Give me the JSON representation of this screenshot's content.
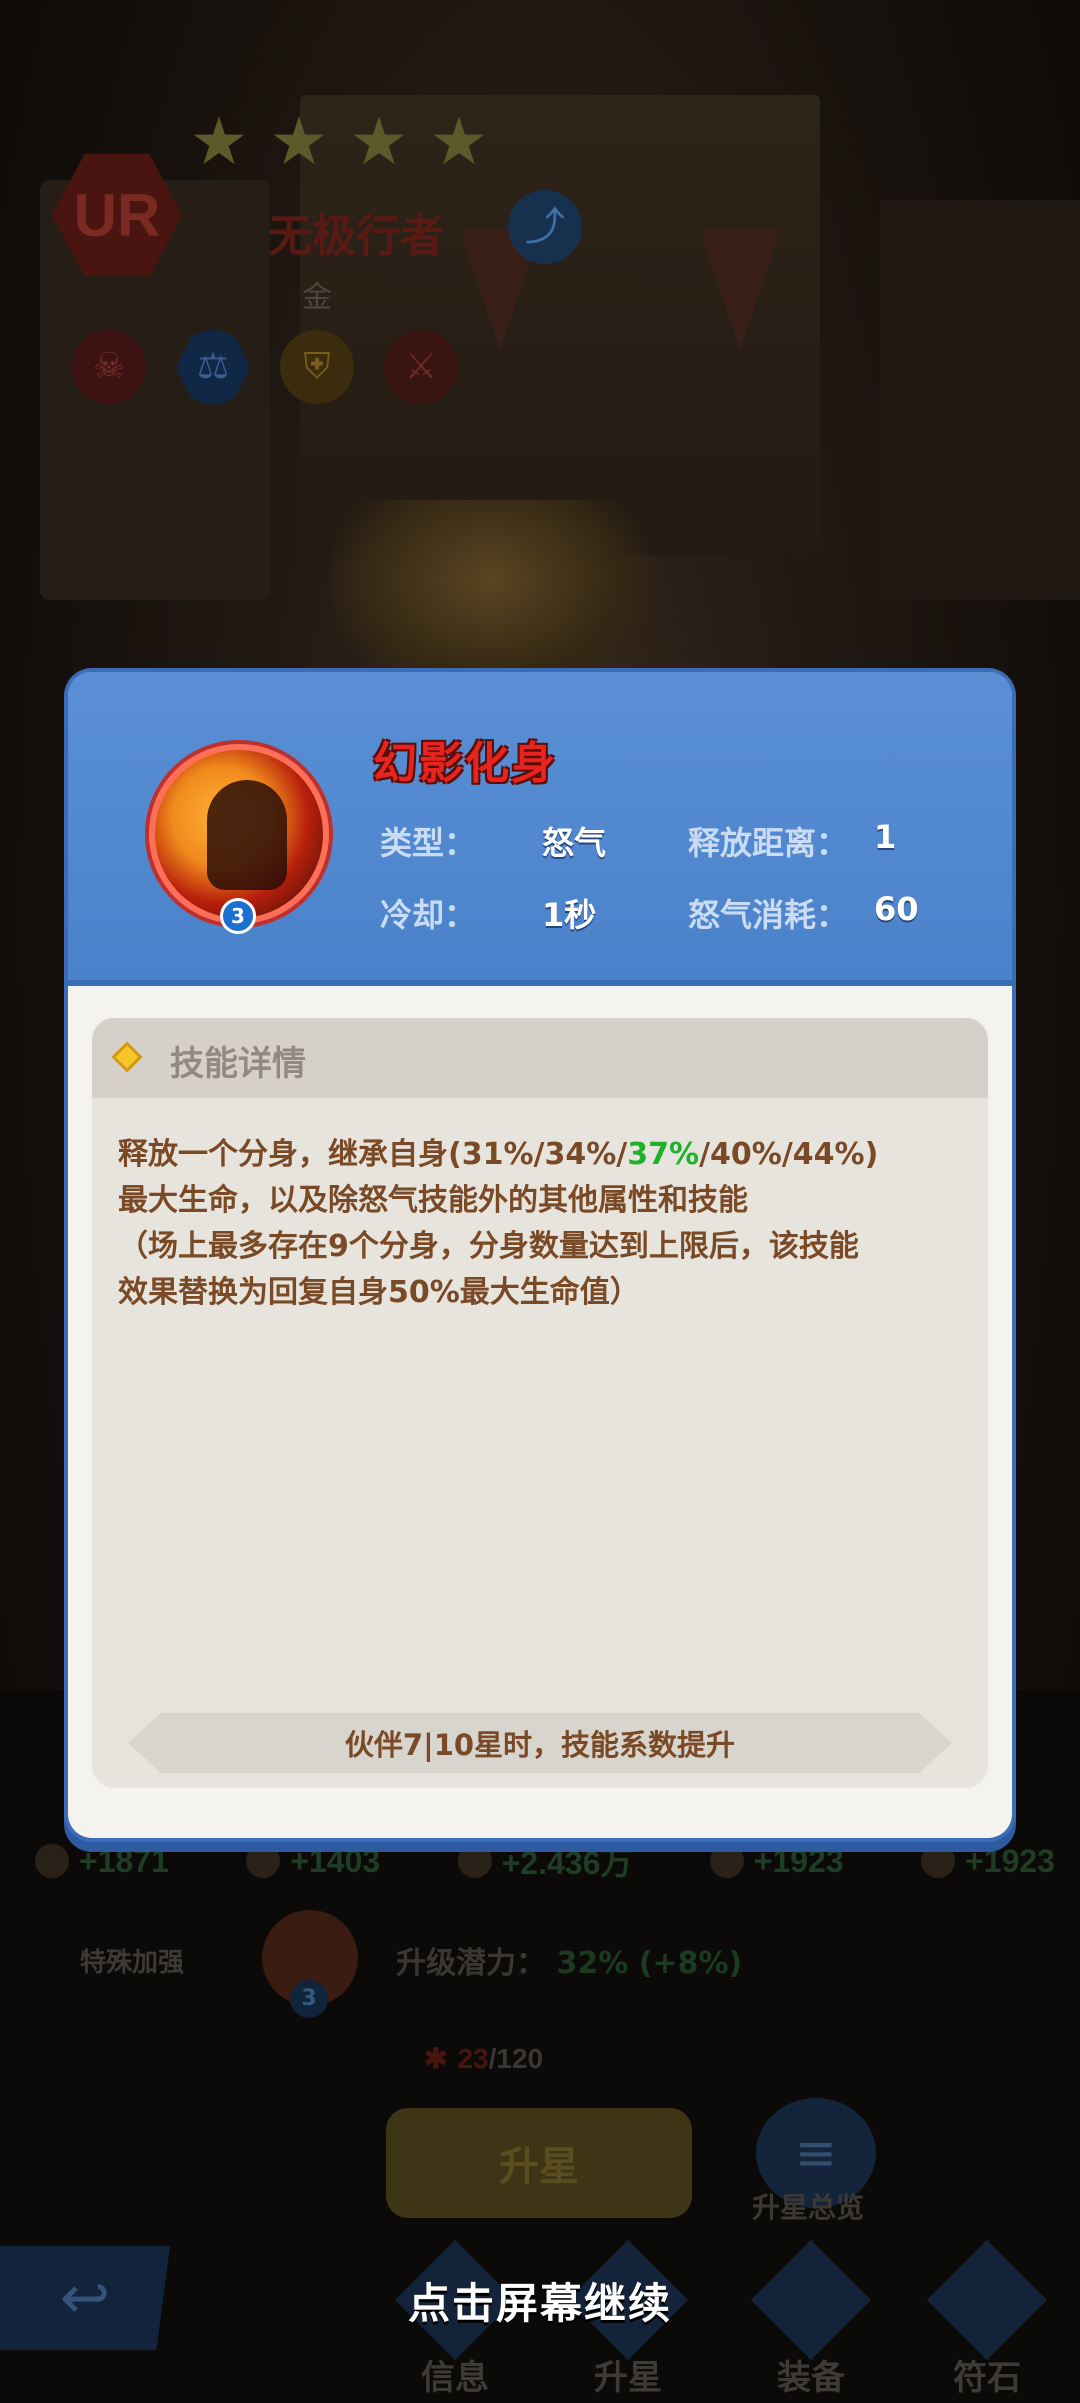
{
  "hero": {
    "rarity": "UR",
    "name": "无极行者",
    "subtitle": "金",
    "stars": 4,
    "trait_icons": [
      "skull-icon",
      "scale-icon",
      "shield-icon",
      "sword-icon"
    ]
  },
  "popup": {
    "skill_name": "幻影化身",
    "skill_level": "3",
    "type_label": "类型：",
    "type_value": "怒气",
    "range_label": "释放距离：",
    "range_value": "1",
    "cooldown_label": "冷却：",
    "cooldown_value": "1秒",
    "rage_cost_label": "怒气消耗：",
    "rage_cost_value": "60",
    "detail_title": "技能详情",
    "desc_line1_pre": "释放一个分身，继承自身(31%/34%/",
    "desc_line1_highlight": "37%",
    "desc_line1_post": "/40%/44%)",
    "desc_line2": "最大生命，以及除怒气技能外的其他属性和技能",
    "desc_line3": "（场上最多存在9个分身，分身数量达到上限后，该技能",
    "desc_line4": "效果替换为回复自身50%最大生命值）",
    "star_tip": "伙伴7|10星时，技能系数提升"
  },
  "stats": [
    "+1871",
    "+1403",
    "+2.436万",
    "+1923",
    "+1923"
  ],
  "special": {
    "label": "特殊加强",
    "level": "3",
    "potential_label": "升级潜力：",
    "potential_value": "32%",
    "potential_bonus": "(+8%)"
  },
  "progress": {
    "current": "23",
    "total": "/120"
  },
  "buttons": {
    "upgrade": "升星",
    "overview": "升星总览"
  },
  "tabs": [
    "信息",
    "升星",
    "装备",
    "符石"
  ],
  "continue_hint": "点击屏幕继续",
  "colors": {
    "popup_header": "#4a82cb",
    "skill_name": "#e8241e",
    "description": "#7a4a26",
    "highlight": "#1fb12a"
  }
}
